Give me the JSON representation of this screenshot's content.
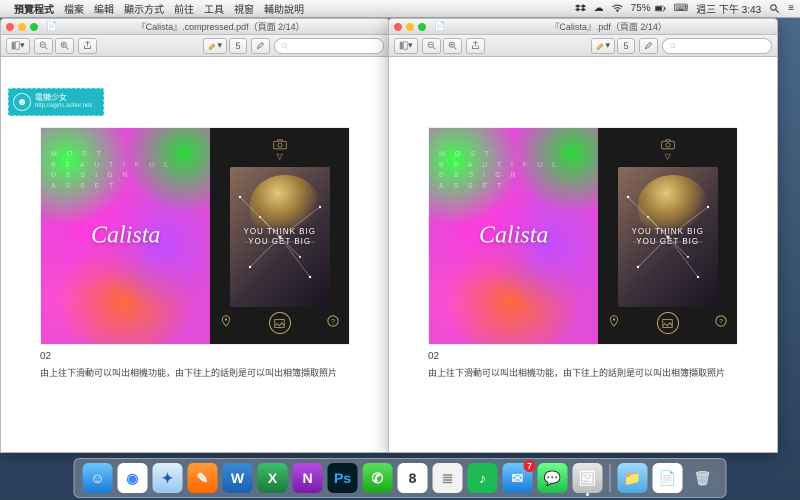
{
  "menubar": {
    "app": "預覽程式",
    "items": [
      "檔案",
      "編輯",
      "顯示方式",
      "前往",
      "工具",
      "視窗",
      "輔助說明"
    ],
    "battery": "75%",
    "clock": "週三 下午 3:43"
  },
  "windows": [
    {
      "title": "『Calista』.compressed.pdf（頁面 2/14）",
      "toolbar_page": "5"
    },
    {
      "title": "『Calista』.pdf（頁面 2/14）",
      "toolbar_page": "5"
    }
  ],
  "watermark": {
    "name": "電獺少女",
    "url": "http://agirls.aotter.net/"
  },
  "pdf": {
    "splash_heading": "M O S T\nB E A U T I F U L\nD E S I G N\nA S S E T",
    "logo": "Calista",
    "photo_text": "YOU THINK BIG\nYOU GET BIG",
    "caption_num": "02",
    "caption_text": "由上往下滑動可以叫出相機功能，由下往上的話則是可以叫出相簿擷取照片"
  },
  "dock": {
    "items": [
      {
        "name": "finder",
        "bg": "linear-gradient(#6cc7ff,#1a7ad6)",
        "glyph": "☺"
      },
      {
        "name": "chrome",
        "bg": "#fff",
        "glyph": "◉",
        "color": "#4285f4"
      },
      {
        "name": "safari",
        "bg": "linear-gradient(#dfeffb,#98c6ef)",
        "glyph": "✦",
        "color": "#1a5fb4"
      },
      {
        "name": "pages",
        "bg": "linear-gradient(#ff9a3a,#ff6a00)",
        "glyph": "✎"
      },
      {
        "name": "word",
        "bg": "linear-gradient(#3a8ad6,#1a5fb4)",
        "glyph": "W"
      },
      {
        "name": "excel",
        "bg": "linear-gradient(#3ac06a,#1a7a3a)",
        "glyph": "X"
      },
      {
        "name": "onenote",
        "bg": "linear-gradient(#b44de0,#7a1aa8)",
        "glyph": "N"
      },
      {
        "name": "photoshop",
        "bg": "#001d26",
        "glyph": "Ps",
        "color": "#31a8ff"
      },
      {
        "name": "line",
        "bg": "linear-gradient(#5ae05a,#1aa81a)",
        "glyph": "✆"
      },
      {
        "name": "calendar",
        "bg": "#fff",
        "glyph": "8",
        "color": "#333",
        "badge": ""
      },
      {
        "name": "reminders",
        "bg": "#f2f2f2",
        "glyph": "≣",
        "color": "#888"
      },
      {
        "name": "spotify",
        "bg": "#1db954",
        "glyph": "♪"
      },
      {
        "name": "mail",
        "bg": "linear-gradient(#6cc7ff,#1a7ad6)",
        "glyph": "✉",
        "badge": "7"
      },
      {
        "name": "messages",
        "bg": "linear-gradient(#6cff8a,#1ac04a)",
        "glyph": "💬"
      },
      {
        "name": "preview",
        "bg": "linear-gradient(#e8e8e8,#bcbcbc)",
        "glyph": "🖼",
        "running": true
      },
      {
        "name": "folder",
        "bg": "linear-gradient(#9bdcff,#4aa6e0)",
        "glyph": "📁"
      },
      {
        "name": "doc",
        "bg": "#fff",
        "glyph": "📄",
        "color": "#555"
      },
      {
        "name": "trash",
        "bg": "transparent",
        "glyph": "🗑",
        "color": "#cfd6dd"
      }
    ],
    "sep_before": [
      "folder"
    ]
  }
}
